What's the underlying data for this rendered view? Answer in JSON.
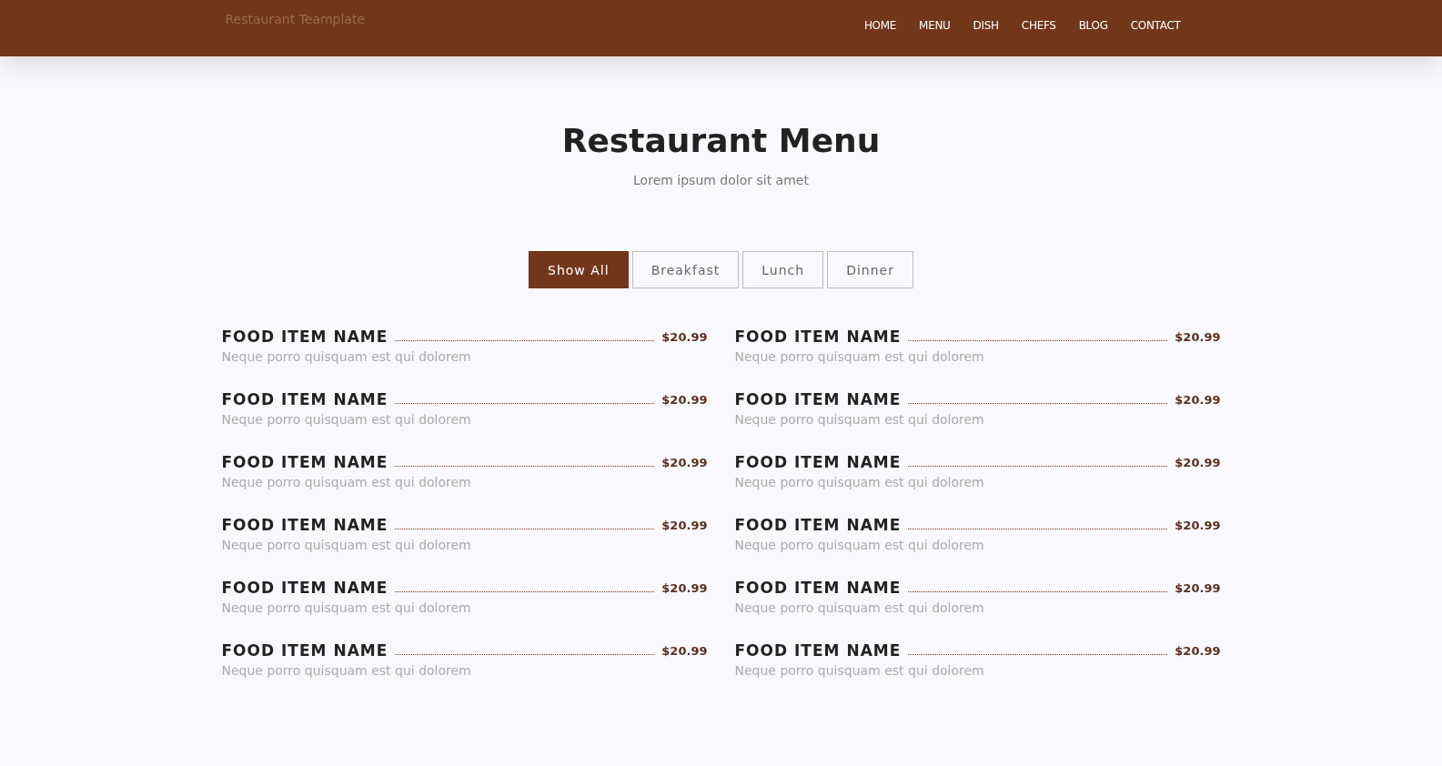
{
  "header": {
    "logo": "Restaurant Teamplate",
    "nav": [
      "HOME",
      "MENU",
      "DISH",
      "CHEFS",
      "BLOG",
      "CONTACT"
    ]
  },
  "section": {
    "title": "Restaurant Menu",
    "subtitle": "Lorem ipsum dolor sit amet"
  },
  "filters": [
    {
      "label": "Show All",
      "selected": true
    },
    {
      "label": "Breakfast",
      "selected": false
    },
    {
      "label": "Lunch",
      "selected": false
    },
    {
      "label": "Dinner",
      "selected": false
    }
  ],
  "items": [
    {
      "name": "FOOD ITEM NAME",
      "price": "$20.99",
      "description": "Neque porro quisquam est qui dolorem"
    },
    {
      "name": "FOOD ITEM NAME",
      "price": "$20.99",
      "description": "Neque porro quisquam est qui dolorem"
    },
    {
      "name": "FOOD ITEM NAME",
      "price": "$20.99",
      "description": "Neque porro quisquam est qui dolorem"
    },
    {
      "name": "FOOD ITEM NAME",
      "price": "$20.99",
      "description": "Neque porro quisquam est qui dolorem"
    },
    {
      "name": "FOOD ITEM NAME",
      "price": "$20.99",
      "description": "Neque porro quisquam est qui dolorem"
    },
    {
      "name": "FOOD ITEM NAME",
      "price": "$20.99",
      "description": "Neque porro quisquam est qui dolorem"
    },
    {
      "name": "FOOD ITEM NAME",
      "price": "$20.99",
      "description": "Neque porro quisquam est qui dolorem"
    },
    {
      "name": "FOOD ITEM NAME",
      "price": "$20.99",
      "description": "Neque porro quisquam est qui dolorem"
    },
    {
      "name": "FOOD ITEM NAME",
      "price": "$20.99",
      "description": "Neque porro quisquam est qui dolorem"
    },
    {
      "name": "FOOD ITEM NAME",
      "price": "$20.99",
      "description": "Neque porro quisquam est qui dolorem"
    },
    {
      "name": "FOOD ITEM NAME",
      "price": "$20.99",
      "description": "Neque porro quisquam est qui dolorem"
    },
    {
      "name": "FOOD ITEM NAME",
      "price": "$20.99",
      "description": "Neque porro quisquam est qui dolorem"
    }
  ]
}
